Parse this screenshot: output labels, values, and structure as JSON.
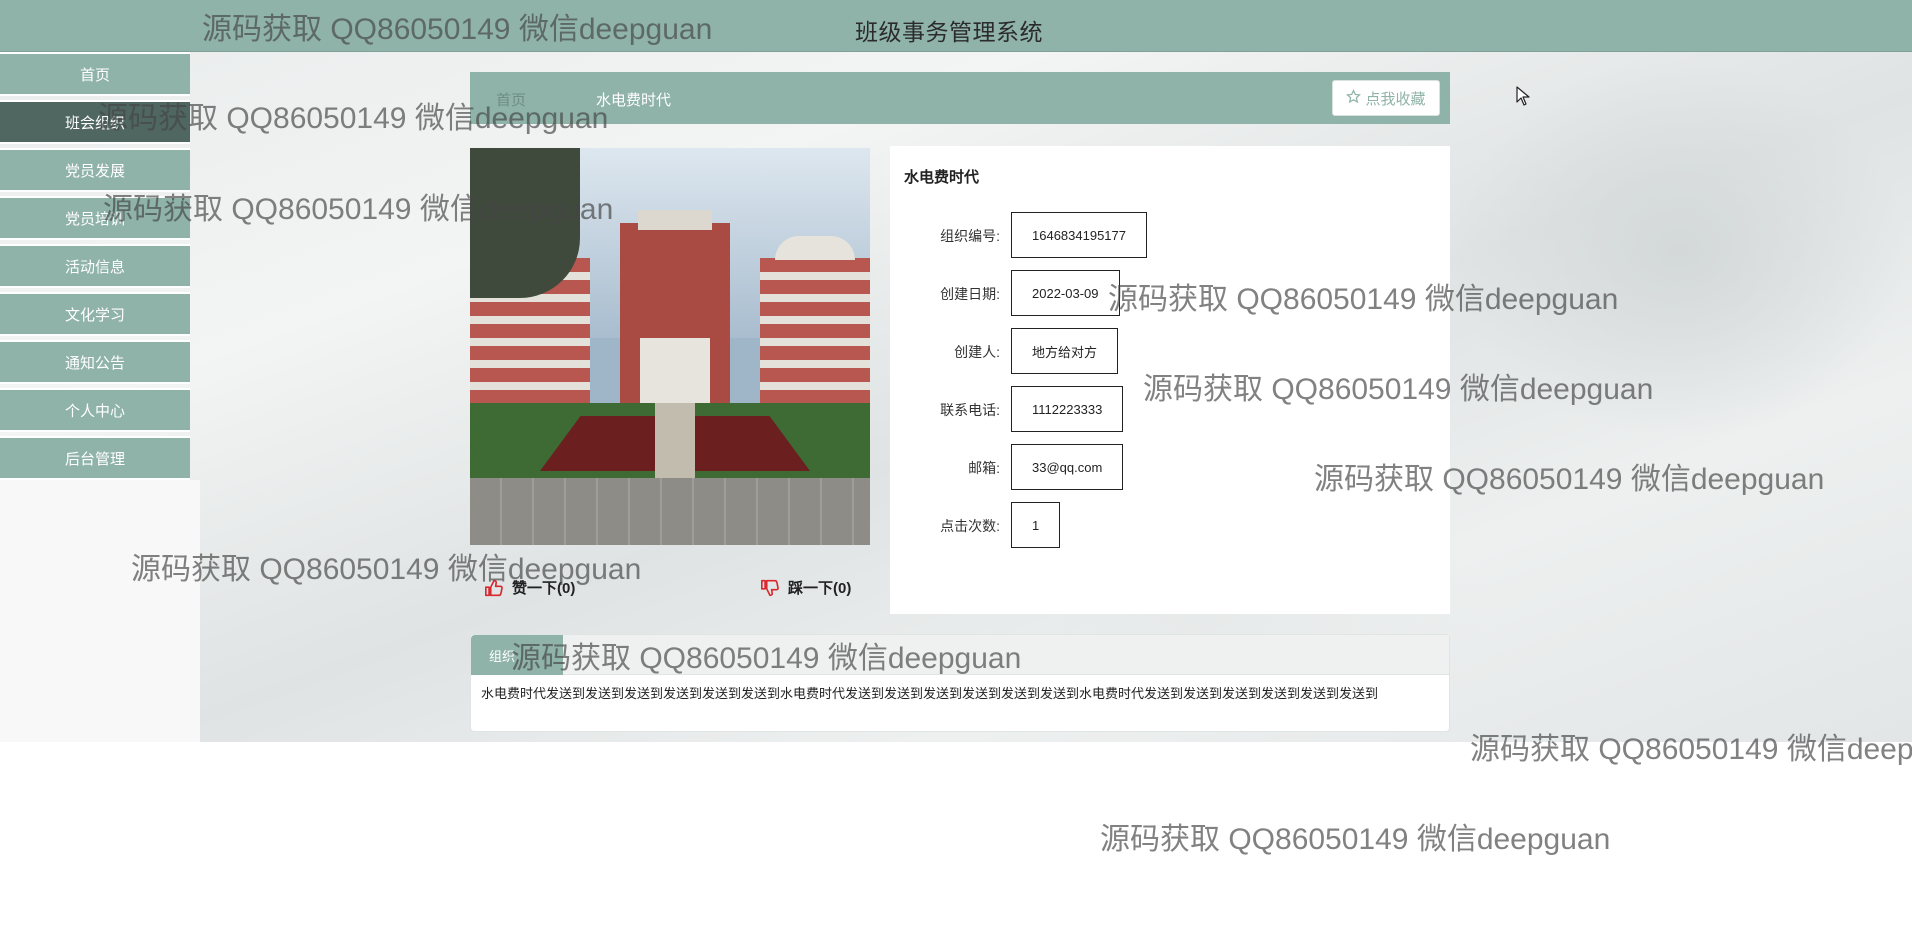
{
  "header": {
    "title": "班级事务管理系统"
  },
  "nav": {
    "items": [
      {
        "label": "首页"
      },
      {
        "label": "班会组织"
      },
      {
        "label": "党员发展"
      },
      {
        "label": "党员培训"
      },
      {
        "label": "活动信息"
      },
      {
        "label": "文化学习"
      },
      {
        "label": "通知公告"
      },
      {
        "label": "个人中心"
      },
      {
        "label": "后台管理"
      }
    ],
    "active_index": 1
  },
  "breadcrumb": {
    "home": "首页",
    "current": "水电费时代"
  },
  "favorite_button": {
    "label": "点我收藏",
    "icon": "star-outline-icon"
  },
  "detail": {
    "name": "水电费时代",
    "fields": [
      {
        "label": "组织编号:",
        "value": "1646834195177"
      },
      {
        "label": "创建日期:",
        "value": "2022-03-09"
      },
      {
        "label": "创建人:",
        "value": "地方给对方"
      },
      {
        "label": "联系电话:",
        "value": "1112223333"
      },
      {
        "label": "邮箱:",
        "value": "33@qq.com"
      },
      {
        "label": "点击次数:",
        "value": "1"
      }
    ]
  },
  "votes": {
    "up_label": "赞一下(0)",
    "down_label": "踩一下(0)",
    "up_icon": "thumbs-up-icon",
    "down_icon": "thumbs-down-icon"
  },
  "description": {
    "tab_label": "组织",
    "text": "水电费时代发送到发送到发送到发送到发送到发送到水电费时代发送到发送到发送到发送到发送到发送到水电费时代发送到发送到发送到发送到发送到发送到"
  },
  "watermark": {
    "text": "源码获取 QQ86050149 微信deepguan"
  },
  "colors": {
    "primary": "#8fb3a8",
    "nav_active": "#4f6661",
    "vote_icon": "#d9272e"
  }
}
